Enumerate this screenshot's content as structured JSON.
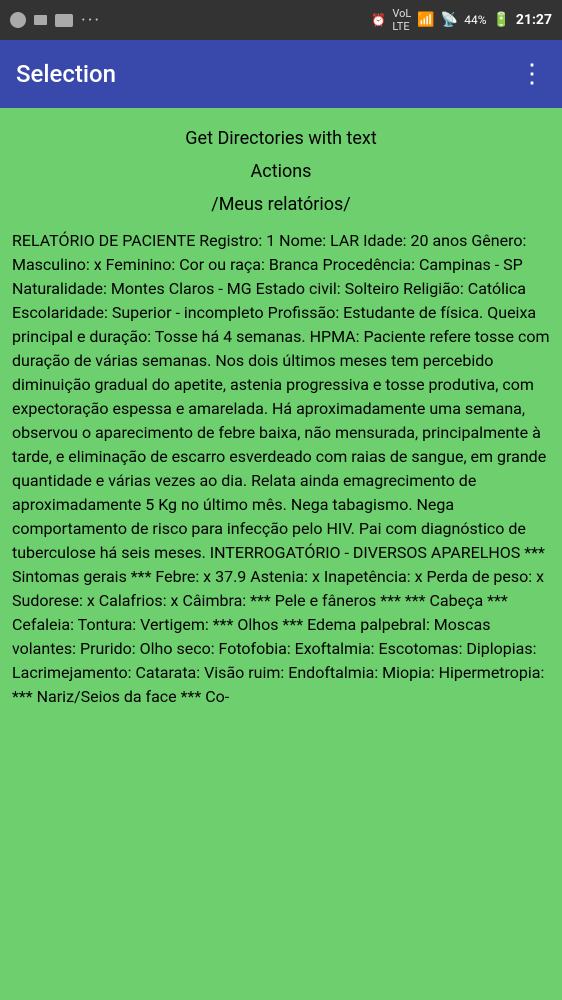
{
  "statusBar": {
    "leftIcons": [
      "circle-icon",
      "square-icon",
      "image-icon",
      "more-icon"
    ],
    "time": "21:27",
    "rightIcons": [
      "alarm-icon",
      "vol-lte-icon",
      "wifi-icon",
      "signal-icon",
      "battery-icon"
    ],
    "battery": "44%"
  },
  "appBar": {
    "title": "Selection",
    "moreIcon": "⋮"
  },
  "content": {
    "getDirectoriesLabel": "Get Directories with text",
    "actionsLabel": "Actions",
    "reportPath": "/Meus relatórios/",
    "reportText": "RELATÓRIO DE PACIENTE Registro: 1 Nome: LAR Idade: 20 anos Gênero: Masculino: x Feminino: Cor ou raça: Branca Procedência: Campinas - SP Naturalidade: Montes Claros - MG Estado civil: Solteiro Religião: Católica Escolaridade: Superior - incompleto Profissão: Estudante de física. Queixa principal e duração: Tosse há 4 semanas. HPMA: Paciente refere tosse com duração de várias semanas. Nos dois últimos meses tem percebido diminuição gradual do apetite, astenia progressiva e tosse produtiva, com expectoração espessa e amarelada. Há aproximadamente uma semana, observou o aparecimento de febre baixa, não mensurada, principalmente à tarde, e eliminação de escarro esverdeado com raias de sangue, em grande quantidade e várias vezes ao dia. Relata ainda emagrecimento de aproximadamente 5 Kg no último mês. Nega tabagismo. Nega comportamento de risco para infecção pelo HIV. Pai com diagnóstico de tuberculose há seis meses. INTERROGATÓRIO - DIVERSOS APARELHOS *** Sintomas gerais *** Febre: x 37.9 Astenia: x Inapetência: x Perda de peso: x Sudorese: x Calafrios: x Câimbra: *** Pele e fâneros *** *** Cabeça *** Cefaleia: Tontura: Vertigem: *** Olhos *** Edema palpebral: Moscas volantes: Prurido: Olho seco: Fotofobia: Exoftalmia: Escotomas: Diplopias: Lacrimejamento: Catarata: Visão ruim: Endoftalmia: Miopia: Hipermetropia: *** Nariz/Seios da face *** Co-"
  }
}
